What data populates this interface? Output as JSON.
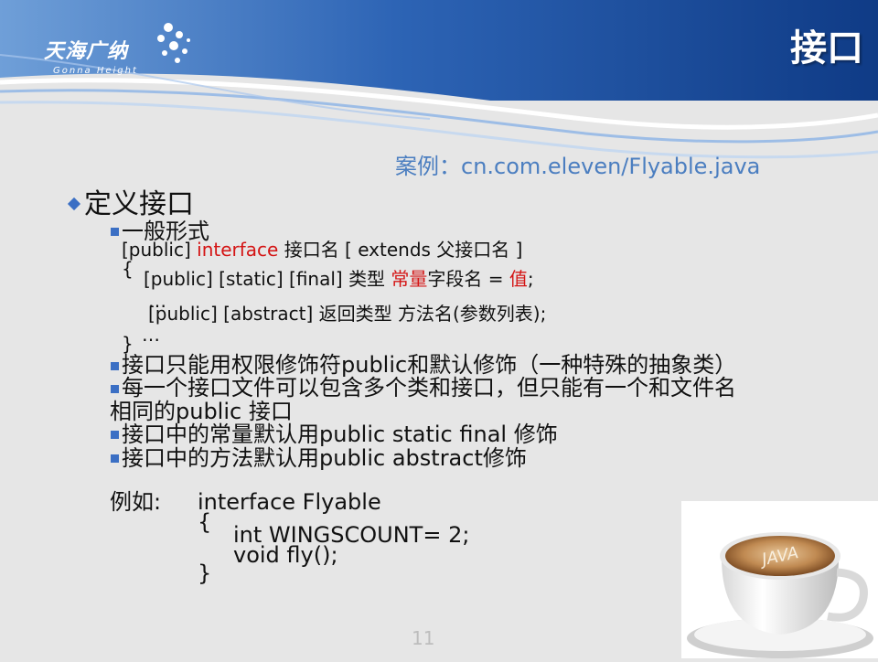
{
  "header": {
    "logo_text": "天海广纳",
    "logo_subtext": "Gonna Height",
    "title": "接口"
  },
  "example_file": "案例：cn.com.eleven/Flyable.java",
  "section": {
    "heading": "定义接口",
    "sub_heading": "一般形式",
    "syntax_line1_a": "[public]",
    "syntax_line1_keyword": "interface",
    "syntax_line1_b": "接口名 [ extends 父接口名 ]",
    "brace_open": "{",
    "field_line_a": "[public] [static] [final] 类型",
    "field_line_keyword1": "常量",
    "field_line_b": "字段名 =",
    "field_line_keyword2": "值",
    "field_line_c": ";",
    "ellipsis_1": "…",
    "method_line": "[public] [abstract] 返回类型 方法名(参数列表);",
    "ellipsis_2": "…",
    "brace_close": "}"
  },
  "bullets": [
    "接口只能用权限修饰符public和默认修饰（一种特殊的抽象类）",
    "每一个接口文件可以包含多个类和接口，但只能有一个和文件名",
    "相同的public 接口",
    "接口中的常量默认用public static final 修饰",
    "接口中的方法默认用public abstract修饰"
  ],
  "example": {
    "label": "例如:",
    "line1": "interface Flyable",
    "line2": "{",
    "line3": "int WINGSCOUNT= 2;",
    "line4": "void fly();",
    "line5": "}"
  },
  "photo_cup_text": "JAVA",
  "page_number": "11",
  "colors": {
    "header_blue": "#1f4f9c",
    "accent_blue": "#4b7ec0",
    "keyword_red": "#d41414",
    "bullet_blue": "#3b6fc4"
  }
}
